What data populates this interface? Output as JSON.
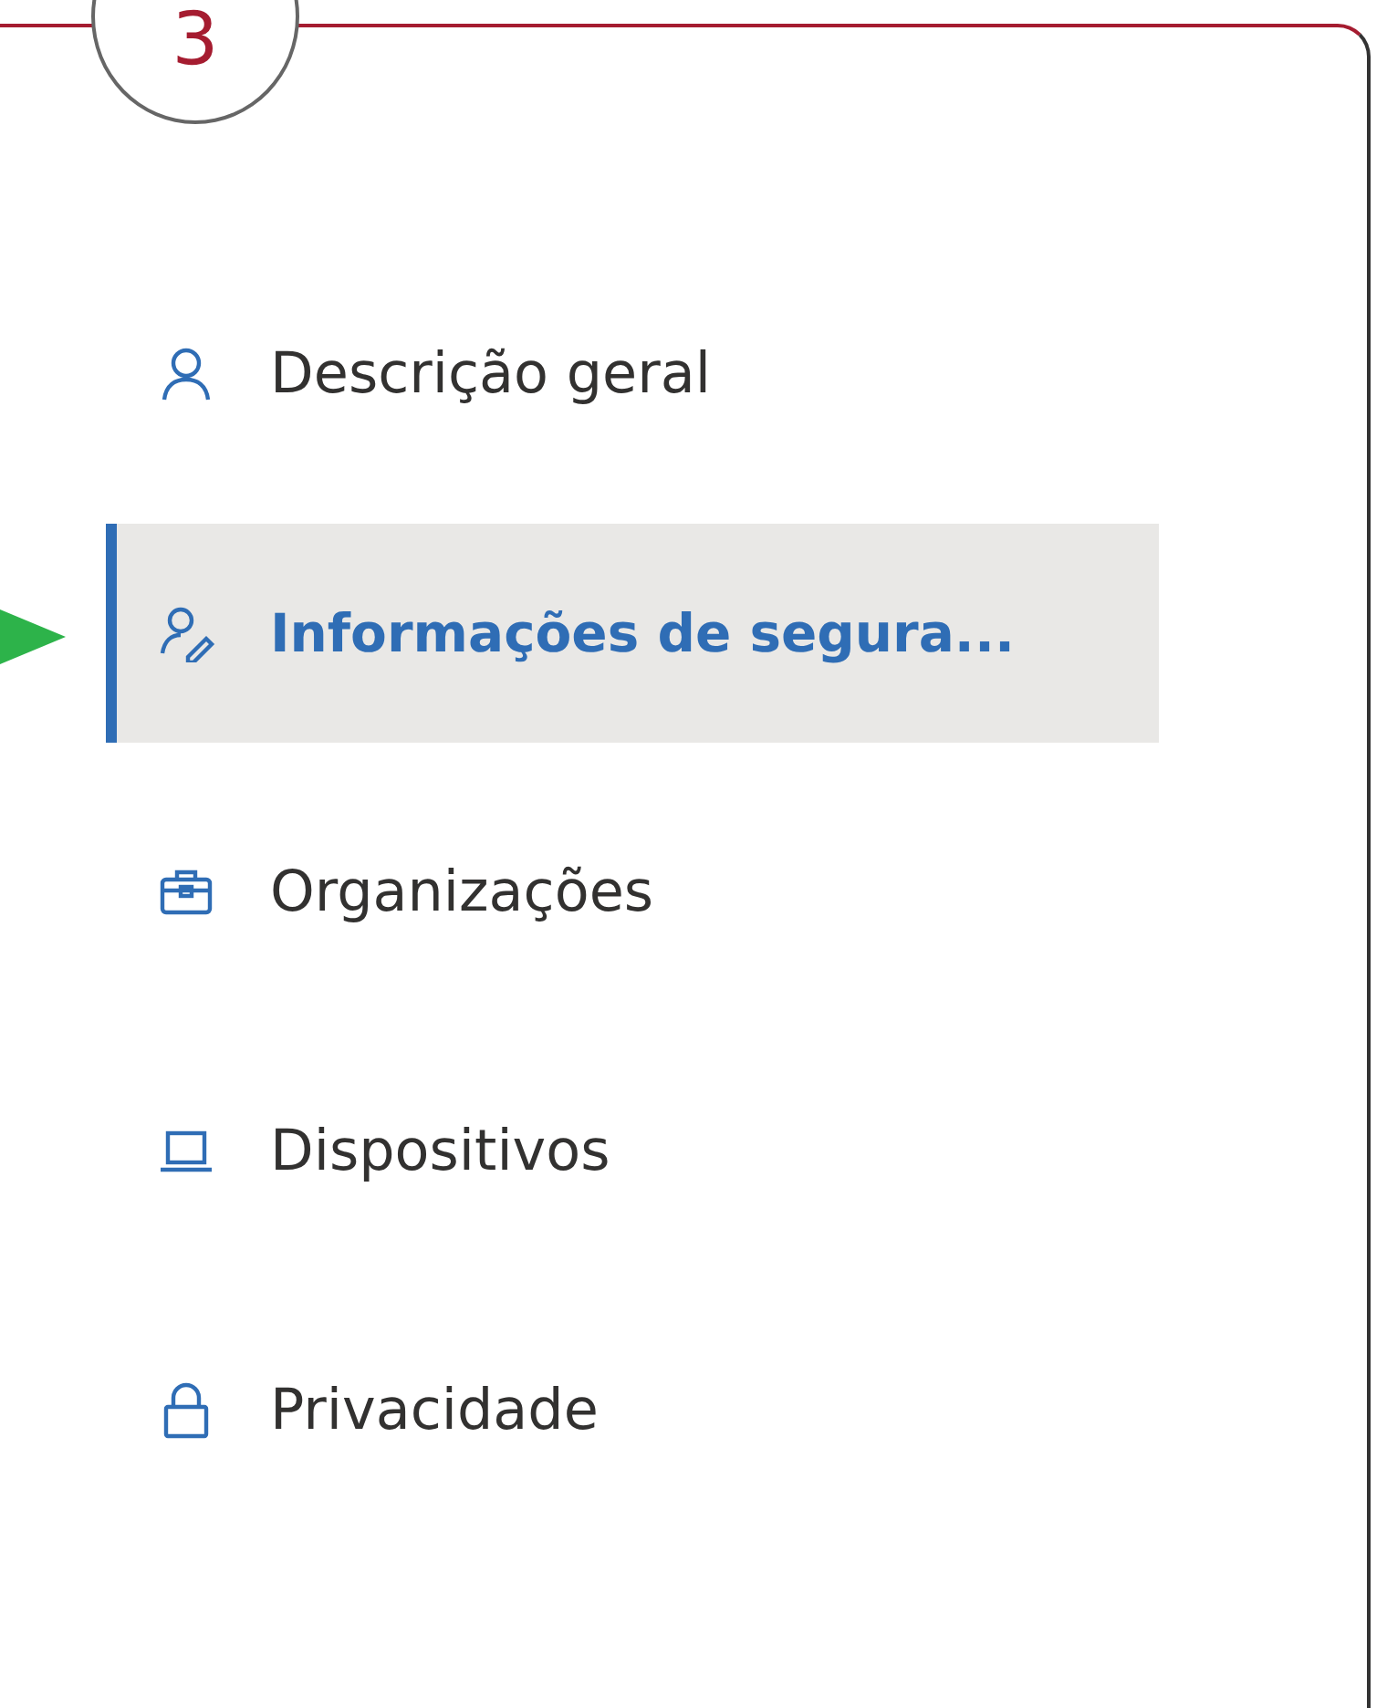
{
  "step_badge": "3",
  "menu": [
    {
      "label": "Descrição geral",
      "selected": false
    },
    {
      "label": "Informações de segura...",
      "selected": true
    },
    {
      "label": "Organizações",
      "selected": false
    },
    {
      "label": "Dispositivos",
      "selected": false
    },
    {
      "label": "Privacidade",
      "selected": false
    }
  ]
}
